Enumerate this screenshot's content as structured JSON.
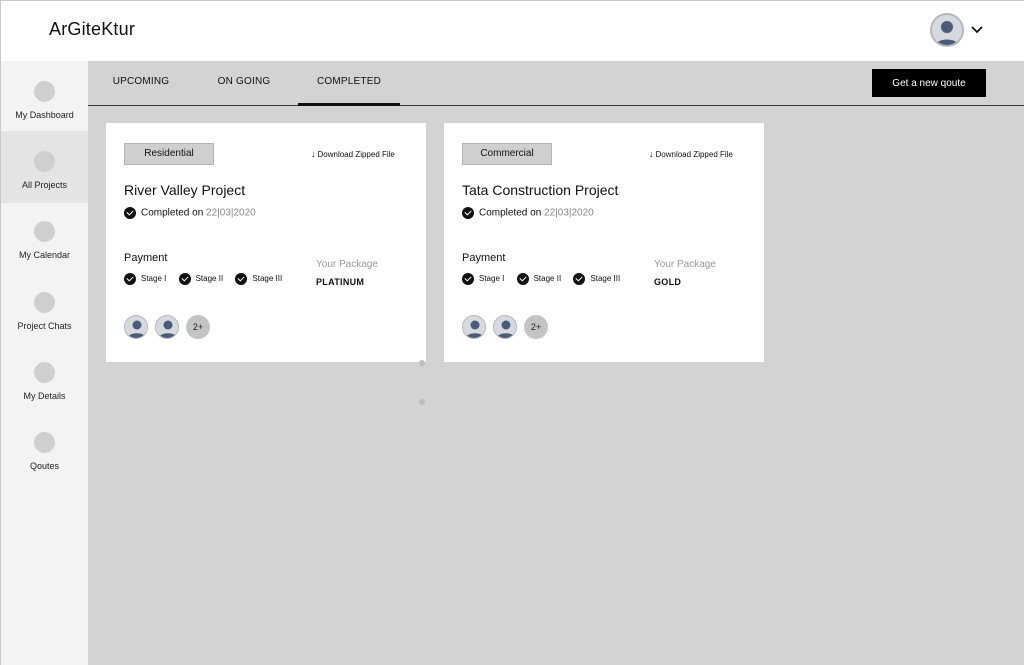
{
  "app": {
    "brand": "ArGiteKtur"
  },
  "header": {
    "avatar_icon": "user-avatar-icon",
    "menu_icon": "chevron-down-icon"
  },
  "sidebar": {
    "items": [
      {
        "label": "My Dashboard",
        "active": false
      },
      {
        "label": "All Projects",
        "active": true
      },
      {
        "label": "My Calendar",
        "active": false
      },
      {
        "label": "Project Chats",
        "active": false
      },
      {
        "label": "My Details",
        "active": false
      },
      {
        "label": "Qoutes",
        "active": false
      }
    ]
  },
  "tabs": [
    {
      "label": "UPCOMING",
      "active": false
    },
    {
      "label": "ON GOING",
      "active": false
    },
    {
      "label": "COMPLETED",
      "active": true
    }
  ],
  "actions": {
    "quote_button": "Get a new qoute"
  },
  "projects": [
    {
      "category": "Residential",
      "download_label": "Download Zipped File",
      "title": "River Valley Project",
      "completed_prefix": "Completed on",
      "completed_date": "22|03|2020",
      "payment_label": "Payment",
      "stages": [
        "Stage I",
        "Stage II",
        "Stage III"
      ],
      "package_label": "Your Package",
      "package": "PLATINUM",
      "more_members": "2+"
    },
    {
      "category": "Commercial",
      "download_label": "Download Zipped File",
      "title": "Tata Construction Project",
      "completed_prefix": "Completed on",
      "completed_date": "22|03|2020",
      "payment_label": "Payment",
      "stages": [
        "Stage I",
        "Stage II",
        "Stage III"
      ],
      "package_label": "Your Package",
      "package": "GOLD",
      "more_members": "2+"
    }
  ],
  "colors": {
    "accent": "#000000",
    "main_bg": "#d3d3d3",
    "sidebar_bg": "#f3f3f3",
    "active_item_bg": "#e4e4e4"
  }
}
